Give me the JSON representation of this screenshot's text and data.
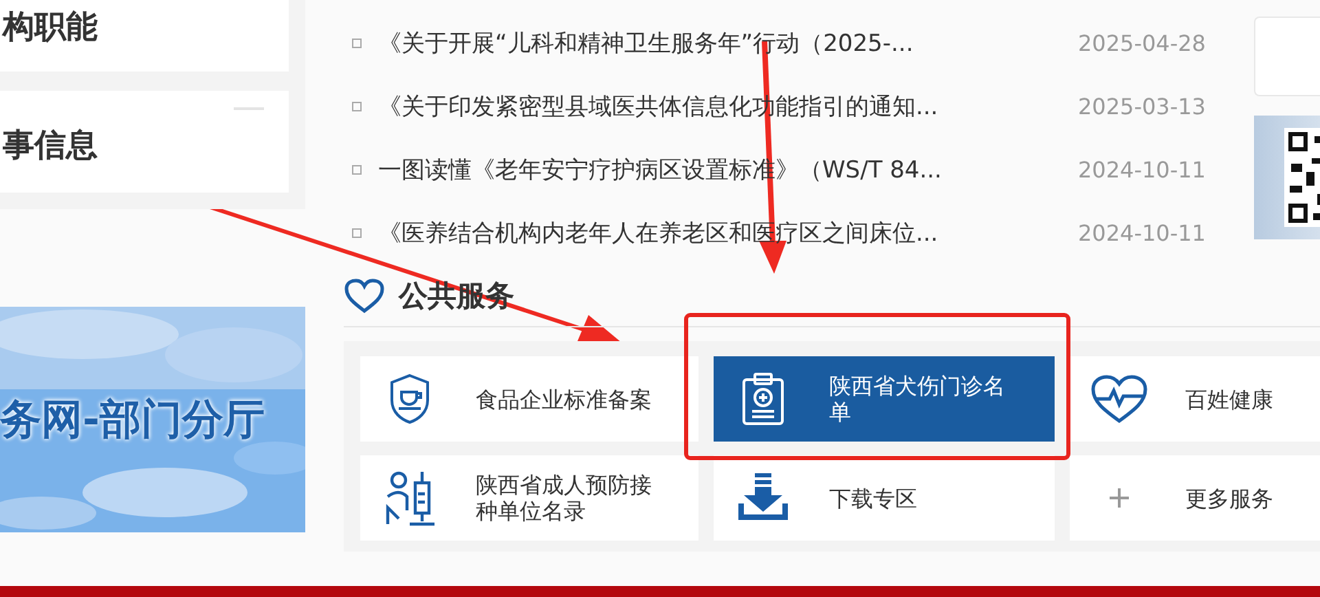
{
  "sidebar": {
    "items": [
      {
        "label": "构职能"
      },
      {
        "label": "事信息"
      }
    ],
    "banner": {
      "kind": "picture",
      "caption": "务网-部门分厅"
    }
  },
  "news": [
    {
      "title": "《关于开展“儿科和精神卫生服务年”行动（2025-...",
      "date": "2025-04-28"
    },
    {
      "title": "《关于印发紧密型县域医共体信息化功能指引的通知...",
      "date": "2025-03-13"
    },
    {
      "title": "一图读懂《老年安宁疗护病区设置标准》（WS/T 84...",
      "date": "2024-10-11"
    },
    {
      "title": "《医养结合机构内老年人在养老区和医疗区之间床位...",
      "date": "2024-10-11"
    }
  ],
  "services": {
    "title": "公共服务",
    "tiles": [
      {
        "label": "食品企业标准备案",
        "kind": "shield",
        "selected": false
      },
      {
        "label": "陕西省犬伤门诊名单",
        "kind": "clipboard",
        "selected": true
      },
      {
        "label": "百姓健康",
        "kind": "heart",
        "selected": false
      },
      {
        "label": "陕西省成人预防接种单位名录",
        "kind": "vaccine",
        "selected": false
      },
      {
        "label": "下载专区",
        "kind": "download",
        "selected": false
      },
      {
        "label": "更多服务",
        "kind": "plus",
        "selected": false
      }
    ]
  }
}
